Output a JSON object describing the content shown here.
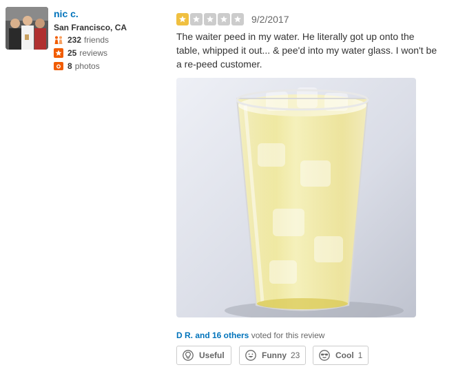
{
  "user": {
    "name": "nic c.",
    "location": "San Francisco, CA",
    "friends_count": "232",
    "friends_label": "friends",
    "reviews_count": "25",
    "reviews_label": "reviews",
    "photos_count": "8",
    "photos_label": "photos"
  },
  "review": {
    "rating": 1,
    "rating_max": 5,
    "date": "9/2/2017",
    "text": "The waiter peed in my water. He literally got up onto the table, whipped it out... & pee'd into my water glass. I won't be a re-peed customer.",
    "photo_icon": "glass-of-yellow-liquid-photo"
  },
  "votes": {
    "voters_link": "D R. and 16 others",
    "voters_suffix": " voted for this review",
    "useful_label": "Useful",
    "funny_label": "Funny",
    "funny_count": "23",
    "cool_label": "Cool",
    "cool_count": "1"
  },
  "colors": {
    "link_blue": "#0073bb",
    "star_on": "#f0c040",
    "star_off": "#cccccc",
    "friends_icon": "#f15c00",
    "reviews_icon": "#f15c00",
    "photos_icon": "#f15c00"
  }
}
